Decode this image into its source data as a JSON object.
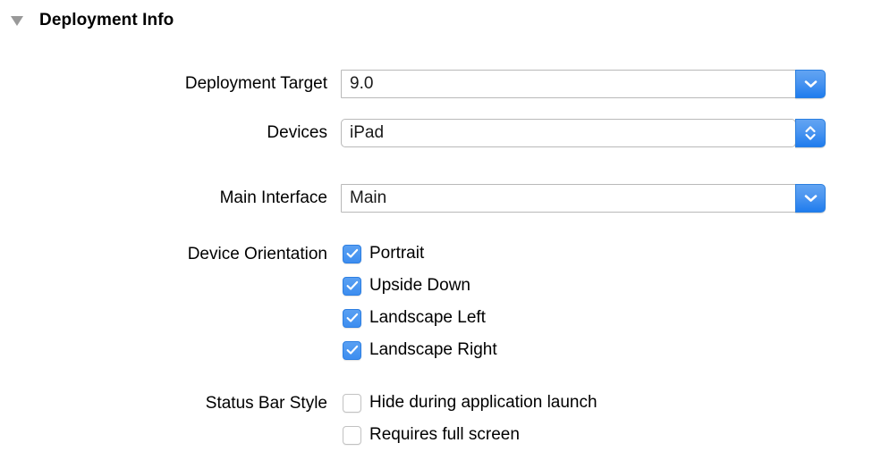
{
  "section": {
    "title": "Deployment Info",
    "disclosure_icon": "triangle-down-icon",
    "expanded": true
  },
  "colors": {
    "accent_blue": "#3d8ef0",
    "button_blue_top": "#62a4f2",
    "button_blue_bottom": "#1f7cee",
    "field_border": "#b9b9b9",
    "background": "#ffffff",
    "text": "#000000",
    "triangle_gray": "#999999"
  },
  "fields": [
    {
      "label": "Deployment Target",
      "value": "9.0",
      "control": "popup",
      "icon": "chevron-down-icon",
      "style": "square"
    },
    {
      "label": "Devices",
      "value": "iPad",
      "control": "stepper",
      "icon": "chevron-up-down-icon",
      "style": "rounded"
    },
    {
      "label": "Main Interface",
      "value": "Main",
      "control": "popup",
      "icon": "chevron-down-icon",
      "style": "square"
    }
  ],
  "device_orientation": {
    "label": "Device Orientation",
    "options": [
      {
        "label": "Portrait",
        "checked": true
      },
      {
        "label": "Upside Down",
        "checked": true
      },
      {
        "label": "Landscape Left",
        "checked": true
      },
      {
        "label": "Landscape Right",
        "checked": true
      }
    ]
  },
  "status_bar_style": {
    "label": "Status Bar Style",
    "options": [
      {
        "label": "Hide during application launch",
        "checked": false
      },
      {
        "label": "Requires full screen",
        "checked": false
      }
    ]
  }
}
